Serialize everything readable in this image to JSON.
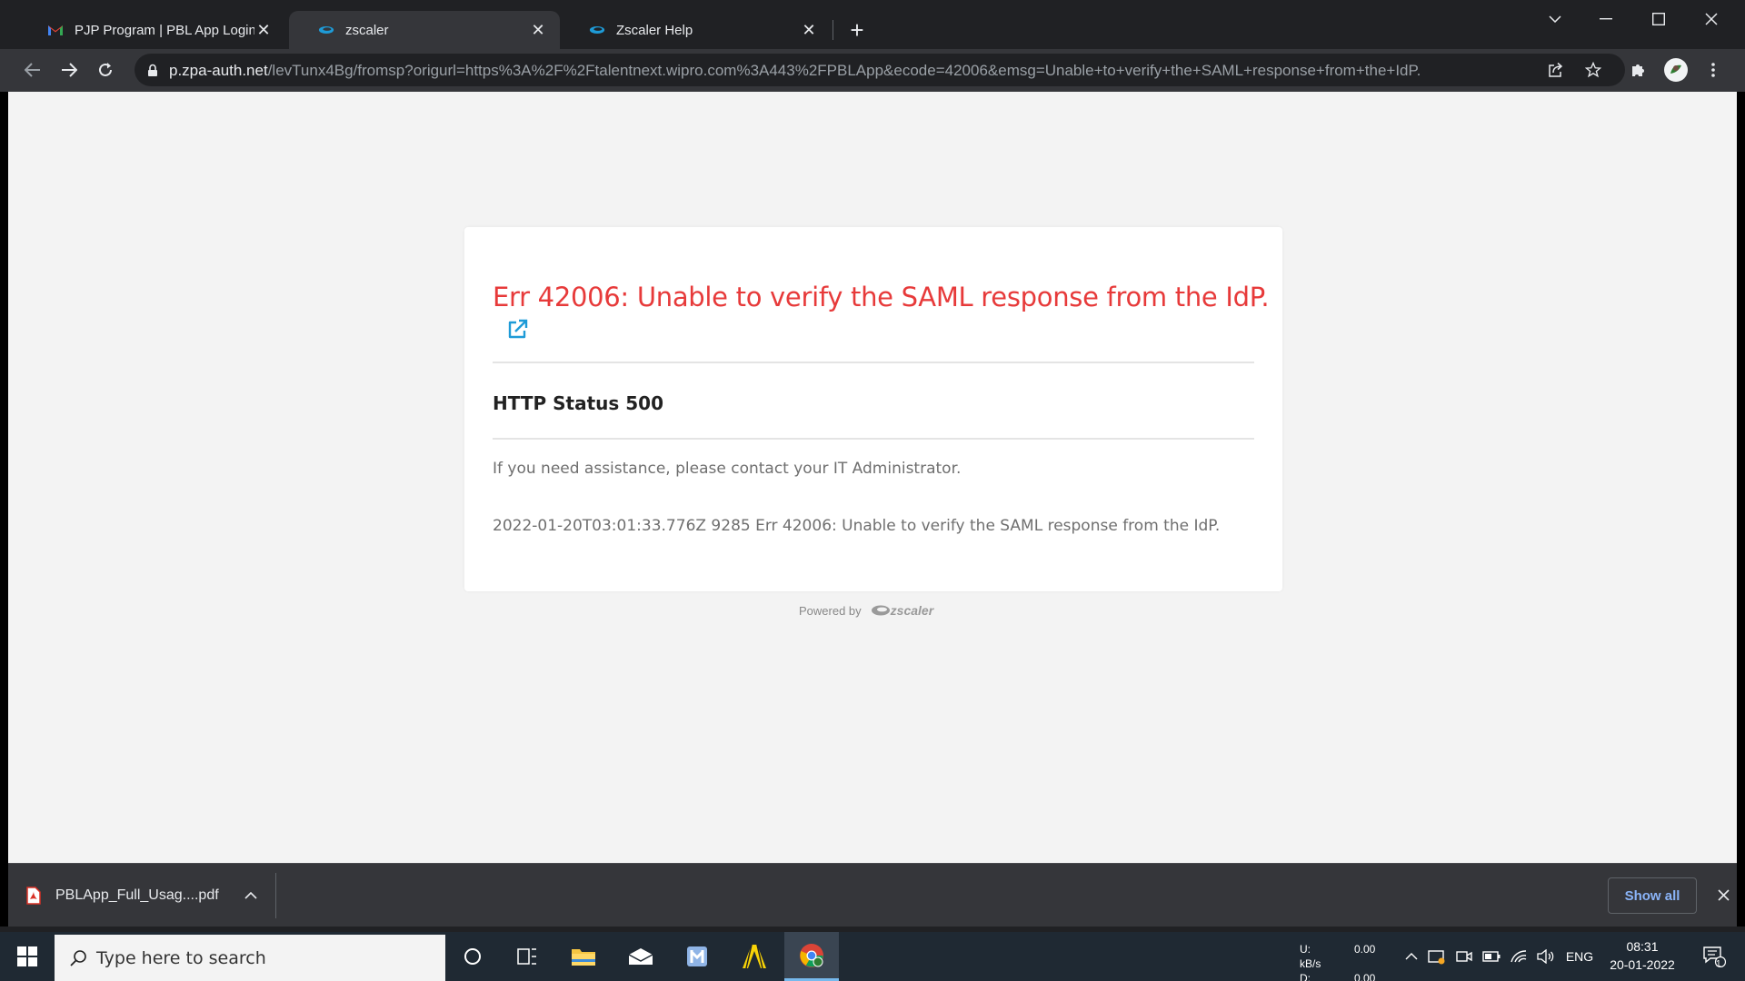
{
  "tabs": [
    {
      "title": "PJP Program | PBL App Login Gui",
      "favicon": "gmail-icon"
    },
    {
      "title": "zscaler",
      "favicon": "zscaler-icon"
    },
    {
      "title": "Zscaler Help",
      "favicon": "zscaler-icon"
    }
  ],
  "address_bar": {
    "host": "p.zpa-auth.net",
    "path": "/levTunx4Bg/fromsp?origurl=https%3A%2F%2Ftalentnext.wipro.com%3A443%2FPBLApp&ecode=42006&emsg=Unable+to+verify+the+SAML+response+from+the+IdP."
  },
  "page": {
    "error_title": "Err 42006: Unable to verify the SAML response from the IdP.",
    "http_status": "HTTP Status 500",
    "assistance": "If you need assistance, please contact your IT Administrator.",
    "log_line": "2022-01-20T03:01:33.776Z 9285 Err 42006: Unable to verify the SAML response from the IdP.",
    "powered_by": "Powered by",
    "logo_text": "zscaler"
  },
  "download_bar": {
    "file_name": "PBLApp_Full_Usag....pdf",
    "show_all": "Show all"
  },
  "taskbar": {
    "search_placeholder": "Type here to search",
    "net_up_label": "U:",
    "net_down_label": "D:",
    "net_up": "0.00 kB/s",
    "net_down": "0.00 kB/s",
    "language": "ENG",
    "time": "08:31",
    "date": "20-01-2022",
    "notification_count": "1"
  },
  "colors": {
    "error_red": "#e73a3a",
    "link_blue": "#1e9bd7",
    "chrome_dark": "#202124",
    "taskbar": "#1f2933"
  }
}
